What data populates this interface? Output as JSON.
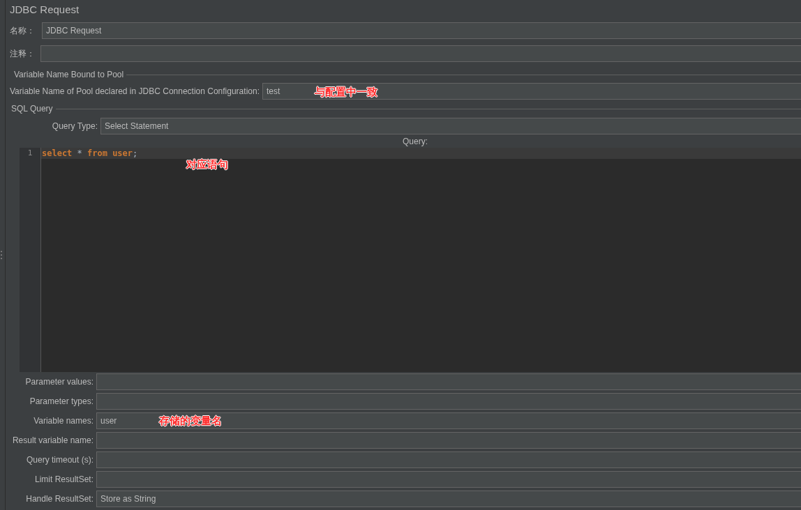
{
  "title": "JDBC Request",
  "name_field": {
    "label": "名称：",
    "value": "JDBC Request"
  },
  "comment_field": {
    "label": "注释："
  },
  "pool_group": {
    "title": "Variable Name Bound to Pool",
    "field": {
      "label": "Variable Name of Pool declared in JDBC Connection Configuration:",
      "value": "test",
      "annotation": "与配置中一致"
    }
  },
  "sql_group": {
    "title": "SQL Query",
    "query_type": {
      "label": "Query Type:",
      "value": "Select Statement"
    },
    "query_label": "Query:",
    "editor": {
      "annotation": "对应语句",
      "lines": [
        {
          "number": "1",
          "current": true,
          "tokens": [
            {
              "kind": "keyword",
              "text": "select"
            },
            {
              "kind": "plain",
              "text": " * "
            },
            {
              "kind": "keyword",
              "text": "from"
            },
            {
              "kind": "keyword",
              "text": "user"
            },
            {
              "kind": "plain",
              "text": ";"
            }
          ]
        }
      ]
    }
  },
  "fields": [
    {
      "label": "Parameter values:"
    },
    {
      "label": "Parameter types:"
    },
    {
      "label": "Variable names:",
      "value": "user",
      "annotation": "存储的变量名"
    },
    {
      "label": "Result variable name:"
    },
    {
      "label": "Query timeout (s):"
    },
    {
      "label": "Limit ResultSet:"
    },
    {
      "label": "Handle ResultSet:",
      "value": "Store as String"
    }
  ]
}
